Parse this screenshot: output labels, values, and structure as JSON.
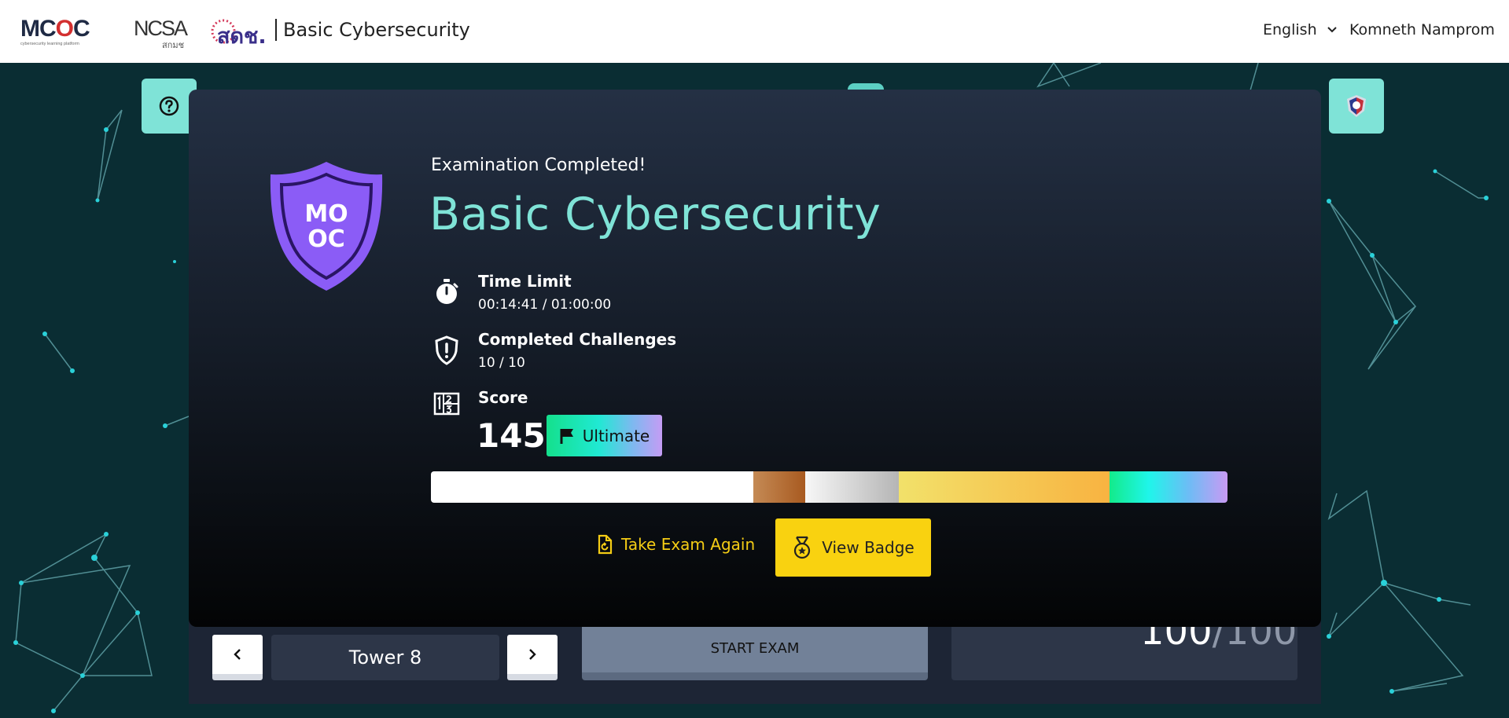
{
  "header": {
    "logo_mooc_text": "MOOC",
    "logo_mooc_tagline": "cybersecurity learning platform",
    "logo_ncsa_text": "NCSA",
    "logo_ncsa_sub": "สกมช",
    "logo_thai_text": "สดช.",
    "title": "Basic Cybersecurity",
    "language": "English",
    "user_name": "Komneth Namprom"
  },
  "icons": {
    "help": "question-circle-icon",
    "shield": "shield-icon",
    "timer": "stopwatch-icon",
    "challenges": "shield-exclamation-icon",
    "score": "number-grid-icon",
    "flag": "flag-icon",
    "retake": "file-rotate-icon",
    "badge": "medal-icon",
    "prev": "chevron-left-icon",
    "next": "chevron-right-icon",
    "lang_dropdown": "chevron-down-icon"
  },
  "modal": {
    "status_text": "Examination Completed!",
    "badge_letters_top": "MO",
    "badge_letters_bottom": "OC",
    "course_title": "Basic Cybersecurity",
    "time_limit": {
      "label": "Time Limit",
      "value": "00:14:41 / 01:00:00"
    },
    "challenges": {
      "label": "Completed Challenges",
      "value": "10 / 10"
    },
    "score": {
      "label": "Score",
      "value": "145",
      "tier": "Ultimate"
    },
    "tier_bar_colors": [
      "#ffffff",
      "#b5733c",
      "#d7d7d7",
      "#f6c94a",
      "#2af0c8"
    ],
    "actions": {
      "take_again": "Take Exam Again",
      "view_badge": "View Badge"
    }
  },
  "lower_panel": {
    "tower_label": "Tower 8",
    "start_exam": "START EXAM",
    "score_num": "100",
    "score_den": "/100"
  },
  "colors": {
    "accent_teal": "#7fe3d7",
    "badge_purple": "#8b5cf6",
    "action_yellow": "#f9d210",
    "bg_dark_teal": "#0a2d33"
  }
}
